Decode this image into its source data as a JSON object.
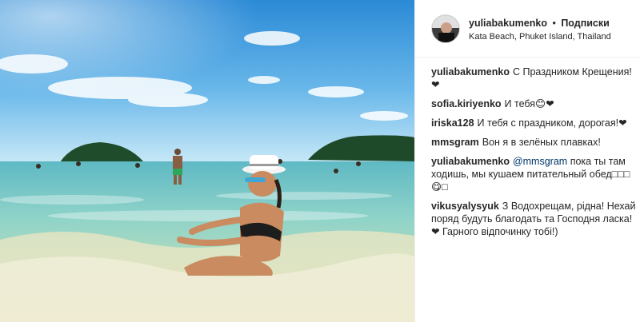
{
  "post": {
    "username": "yuliabakumenko",
    "separator": "•",
    "follow_label": "Подписки",
    "location": "Kata Beach, Phuket Island, Thailand"
  },
  "comments": [
    {
      "user": "yuliabakumenko",
      "mention": "",
      "text": "С Праздником Крещения! ❤"
    },
    {
      "user": "sofia.kiriyenko",
      "mention": "",
      "text": "И тебя😊❤"
    },
    {
      "user": "iriska128",
      "mention": "",
      "text": "И тебя с праздником, дорогая!❤"
    },
    {
      "user": "mmsgram",
      "mention": "",
      "text": "Вон я в зелёных плавках!"
    },
    {
      "user": "yuliabakumenko",
      "mention": "@mmsgram",
      "text": "пока ты там ходишь, мы кушаем питательный обед□□□😋□"
    },
    {
      "user": "vikusyalysyuk",
      "mention": "",
      "text": "З Водохрещам, рідна! Нехай поряд будуть благодать та Господня ласка! ❤ Гарного відпочинку тобі!)"
    }
  ],
  "colors": {
    "sky_top": "#2f8fd8",
    "sky_bottom": "#bfe3f5",
    "sea": "#7ec9c4",
    "mention": "#003569"
  },
  "icons": {
    "avatar": "user-avatar-photo"
  }
}
